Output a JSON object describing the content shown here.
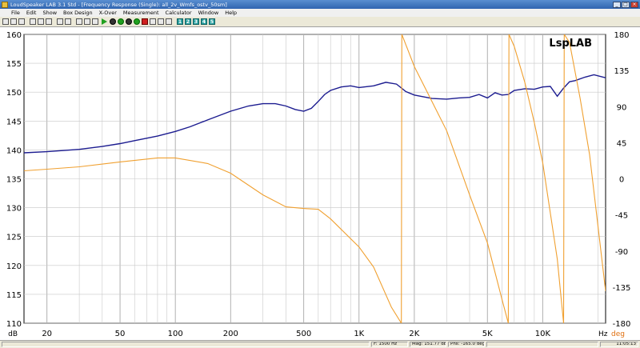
{
  "window": {
    "title": "LoudSpeaker LAB 3.1 Std - [Frequency Response (Single): all_2v_Wmfs_ostv_50sm]"
  },
  "menu": [
    "File",
    "Edit",
    "Show",
    "Box Design",
    "X-Over",
    "Measurement",
    "Calculator",
    "Window",
    "Help"
  ],
  "toolbar": {
    "numbered_buttons": [
      "1",
      "2",
      "3",
      "4",
      "5"
    ]
  },
  "plot": {
    "logo": "LspLAB",
    "left_unit": "dB",
    "right_unit": "deg",
    "x_unit": "Hz"
  },
  "status": {
    "freq": "F: 1500 Hz",
    "mag": "Mag: 151.77 dB",
    "phs": "Phs: -165.0 deg",
    "time": "11:05:13"
  },
  "colors": {
    "magnitude": "#1c1c90",
    "phase": "#f0a030",
    "grid": "#c8c8c8",
    "right_axis_label": "#e07010"
  },
  "chart_data": {
    "type": "line",
    "x_scale": "log",
    "xlim": [
      15,
      22000
    ],
    "x_ticks": [
      20,
      50,
      100,
      200,
      500,
      1000,
      2000,
      5000,
      10000
    ],
    "x_tick_labels": [
      "20",
      "50",
      "100",
      "200",
      "500",
      "1K",
      "2K",
      "5K",
      "10K"
    ],
    "y_left_lim": [
      110,
      160
    ],
    "y_left_ticks": [
      110,
      115,
      120,
      125,
      130,
      135,
      140,
      145,
      150,
      155,
      160
    ],
    "y_right_lim": [
      -180,
      180
    ],
    "y_right_ticks": [
      -180,
      -135,
      -90,
      -45,
      0,
      45,
      90,
      135,
      180
    ],
    "grid": true,
    "series": [
      {
        "axis": "left",
        "x": [
          15,
          20,
          30,
          40,
          50,
          60,
          80,
          100,
          120,
          150,
          200,
          250,
          300,
          350,
          400,
          450,
          500,
          550,
          600,
          650,
          700,
          800,
          900,
          1000,
          1200,
          1400,
          1600,
          1800,
          2000,
          2500,
          3000,
          3500,
          4000,
          4500,
          5000,
          5500,
          6000,
          6500,
          7000,
          8000,
          9000,
          10000,
          11000,
          12000,
          13000,
          14000,
          15000,
          17000,
          19000,
          22000
        ],
        "y": [
          139.5,
          139.7,
          140.1,
          140.6,
          141.1,
          141.6,
          142.4,
          143.2,
          144.0,
          145.2,
          146.7,
          147.6,
          148.0,
          148.0,
          147.6,
          147.0,
          146.7,
          147.2,
          148.4,
          149.6,
          150.3,
          150.9,
          151.1,
          150.8,
          151.1,
          151.7,
          151.4,
          150.1,
          149.5,
          148.9,
          148.8,
          149.0,
          149.1,
          149.6,
          149.0,
          149.9,
          149.5,
          149.6,
          150.3,
          150.6,
          150.5,
          150.9,
          151.0,
          149.3,
          150.7,
          151.8,
          152.0,
          152.6,
          153.0,
          152.5
        ]
      },
      {
        "axis": "right",
        "x": [
          15,
          20,
          30,
          50,
          80,
          100,
          150,
          200,
          300,
          400,
          500,
          600,
          700,
          1000,
          1200,
          1500,
          1700,
          1710,
          2000,
          3000,
          4000,
          5000,
          6000,
          6500,
          6550,
          7000,
          8000,
          9000,
          10000,
          12000,
          13000,
          13100,
          14000,
          16000,
          18000,
          22000
        ],
        "y": [
          10,
          12,
          15,
          21,
          26,
          26,
          19,
          7,
          -20,
          -35,
          -37,
          -38,
          -50,
          -85,
          -110,
          -160,
          -180,
          180,
          140,
          60,
          -20,
          -80,
          -150,
          -180,
          180,
          165,
          120,
          70,
          20,
          -100,
          -180,
          180,
          170,
          100,
          30,
          -140
        ]
      }
    ]
  }
}
